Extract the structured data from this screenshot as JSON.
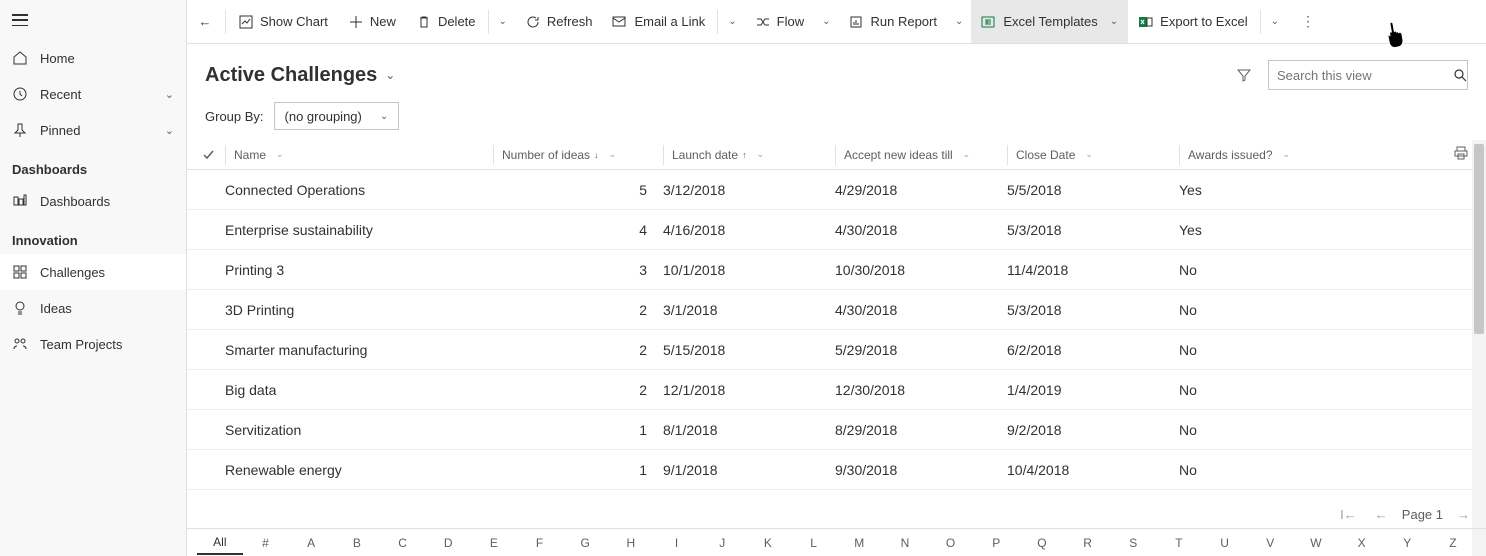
{
  "sidebar": {
    "home": "Home",
    "recent": "Recent",
    "pinned": "Pinned",
    "section_dashboards": "Dashboards",
    "dashboards": "Dashboards",
    "section_innovation": "Innovation",
    "challenges": "Challenges",
    "ideas": "Ideas",
    "team_projects": "Team Projects"
  },
  "commands": {
    "show_chart": "Show Chart",
    "new": "New",
    "delete": "Delete",
    "refresh": "Refresh",
    "email_link": "Email a Link",
    "flow": "Flow",
    "run_report": "Run Report",
    "excel_templates": "Excel Templates",
    "export_excel": "Export to Excel"
  },
  "view": {
    "title": "Active Challenges",
    "groupby_label": "Group By:",
    "groupby_value": "(no grouping)",
    "search_placeholder": "Search this view"
  },
  "columns": {
    "name": "Name",
    "number_of_ideas": "Number of ideas",
    "launch_date": "Launch date",
    "accept_new_ideas_till": "Accept new ideas till",
    "close_date": "Close Date",
    "awards_issued": "Awards issued?"
  },
  "rows": [
    {
      "name": "Connected Operations",
      "num": "5",
      "launch": "3/12/2018",
      "accept": "4/29/2018",
      "close": "5/5/2018",
      "awards": "Yes"
    },
    {
      "name": "Enterprise sustainability",
      "num": "4",
      "launch": "4/16/2018",
      "accept": "4/30/2018",
      "close": "5/3/2018",
      "awards": "Yes"
    },
    {
      "name": "Printing 3",
      "num": "3",
      "launch": "10/1/2018",
      "accept": "10/30/2018",
      "close": "11/4/2018",
      "awards": "No"
    },
    {
      "name": "3D Printing",
      "num": "2",
      "launch": "3/1/2018",
      "accept": "4/30/2018",
      "close": "5/3/2018",
      "awards": "No"
    },
    {
      "name": "Smarter manufacturing",
      "num": "2",
      "launch": "5/15/2018",
      "accept": "5/29/2018",
      "close": "6/2/2018",
      "awards": "No"
    },
    {
      "name": "Big data",
      "num": "2",
      "launch": "12/1/2018",
      "accept": "12/30/2018",
      "close": "1/4/2019",
      "awards": "No"
    },
    {
      "name": "Servitization",
      "num": "1",
      "launch": "8/1/2018",
      "accept": "8/29/2018",
      "close": "9/2/2018",
      "awards": "No"
    },
    {
      "name": "Renewable energy",
      "num": "1",
      "launch": "9/1/2018",
      "accept": "9/30/2018",
      "close": "10/4/2018",
      "awards": "No"
    }
  ],
  "pager": {
    "label": "Page 1"
  },
  "alpha": [
    "All",
    "#",
    "A",
    "B",
    "C",
    "D",
    "E",
    "F",
    "G",
    "H",
    "I",
    "J",
    "K",
    "L",
    "M",
    "N",
    "O",
    "P",
    "Q",
    "R",
    "S",
    "T",
    "U",
    "V",
    "W",
    "X",
    "Y",
    "Z"
  ]
}
